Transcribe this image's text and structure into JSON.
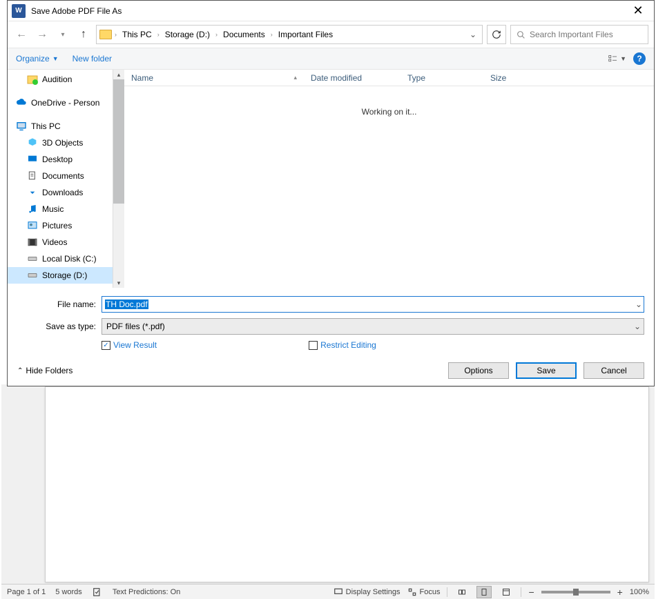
{
  "window": {
    "title": "Save Adobe PDF File As",
    "icon_letter": "W"
  },
  "breadcrumbs": [
    "This PC",
    "Storage (D:)",
    "Documents",
    "Important Files"
  ],
  "search": {
    "placeholder": "Search Important Files"
  },
  "toolbar": {
    "organize": "Organize",
    "newfolder": "New folder"
  },
  "sidebar": {
    "audition": "Audition",
    "onedrive": "OneDrive - Person",
    "thispc": "This PC",
    "items": [
      "3D Objects",
      "Desktop",
      "Documents",
      "Downloads",
      "Music",
      "Pictures",
      "Videos",
      "Local Disk (C:)",
      "Storage (D:)"
    ]
  },
  "columns": {
    "name": "Name",
    "date": "Date modified",
    "type": "Type",
    "size": "Size"
  },
  "listing": {
    "status": "Working on it..."
  },
  "form": {
    "filename_label": "File name:",
    "filename_value": "TH Doc.pdf",
    "type_label": "Save as type:",
    "type_value": "PDF files (*.pdf)",
    "view_result": "View Result",
    "restrict_editing": "Restrict Editing"
  },
  "buttons": {
    "hide": "Hide Folders",
    "options": "Options",
    "save": "Save",
    "cancel": "Cancel"
  },
  "statusbar": {
    "page": "Page 1 of 1",
    "words": "5 words",
    "textpred": "Text Predictions: On",
    "display": "Display Settings",
    "focus": "Focus",
    "zoom": "100%"
  }
}
